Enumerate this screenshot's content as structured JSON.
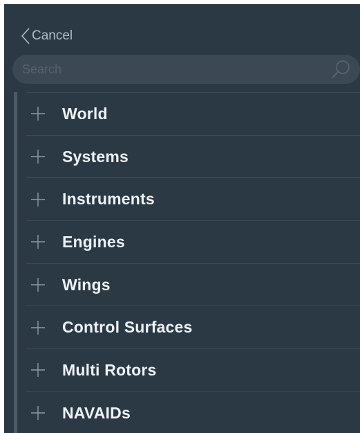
{
  "header": {
    "cancel_label": "Cancel"
  },
  "search": {
    "placeholder": "Search",
    "value": "",
    "icon": "search-icon"
  },
  "categories": [
    {
      "label": "World",
      "icon": "plus-icon"
    },
    {
      "label": "Systems",
      "icon": "plus-icon"
    },
    {
      "label": "Instruments",
      "icon": "plus-icon"
    },
    {
      "label": "Engines",
      "icon": "plus-icon"
    },
    {
      "label": "Wings",
      "icon": "plus-icon"
    },
    {
      "label": "Control Surfaces",
      "icon": "plus-icon"
    },
    {
      "label": "Multi Rotors",
      "icon": "plus-icon"
    },
    {
      "label": "NAVAIDs",
      "icon": "plus-icon"
    }
  ],
  "colors": {
    "background": "#2b3945",
    "search_field": "#3c4955",
    "text": "#eef2f5",
    "muted_text": "#b3bcc5",
    "divider": "#3d4a55",
    "scroll_rail": "#4d5963"
  }
}
